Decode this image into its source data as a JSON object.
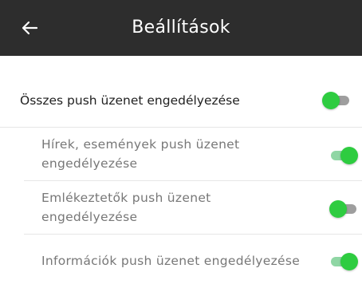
{
  "header": {
    "title": "Beállítások",
    "back_icon": "arrow-left-icon"
  },
  "colors": {
    "header_bg": "#2d2d2d",
    "toggle_knob": "#2ecc40",
    "toggle_track_on": "#8fd6a4",
    "toggle_track_off": "#9e9e9e"
  },
  "settings": {
    "master": {
      "label": "Összes push üzenet engedélyezése",
      "enabled": false
    },
    "items": [
      {
        "label_line1": "Hírek, események push üzenet",
        "label_line2": "engedélyezése",
        "enabled": true
      },
      {
        "label_line1": "Emlékeztetők push üzenet",
        "label_line2": "engedélyezése",
        "enabled": false
      },
      {
        "label": "Információk push üzenet engedélyezése",
        "enabled": true
      }
    ]
  }
}
